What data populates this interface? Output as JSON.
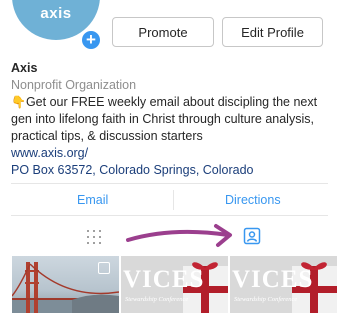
{
  "profile": {
    "avatar_text": "axis",
    "add_icon": "plus-icon"
  },
  "buttons": {
    "promote": "Promote",
    "edit_profile": "Edit Profile"
  },
  "bio": {
    "name": "Axis",
    "category": "Nonprofit Organization",
    "hand_icon": "👇",
    "description": "Get our FREE weekly email about discipling the next gen into lifelong faith in Christ through culture analysis, practical tips, & discussion starters",
    "website": "www.axis.org/",
    "address": "PO Box 63572, Colorado Springs, Colorado"
  },
  "actions": {
    "email": "Email",
    "directions": "Directions"
  },
  "tabs": {
    "grid_icon": "grid-icon",
    "tagged_icon": "tagged-person-icon",
    "annotation_icon": "purple-arrow-annotation"
  },
  "photos": [
    {
      "kind": "golden-gate-bridge"
    },
    {
      "overlay_title": "VICES",
      "overlay_subtitle": "Stewardship Conference"
    },
    {
      "overlay_title": "VICES",
      "overlay_subtitle": "Stewardship Conference"
    }
  ],
  "colors": {
    "accent_blue": "#3897f0",
    "link_navy": "#1b3e7a",
    "arrow_purple": "#9b3f8e",
    "avatar_blue": "#6fb1d6"
  }
}
